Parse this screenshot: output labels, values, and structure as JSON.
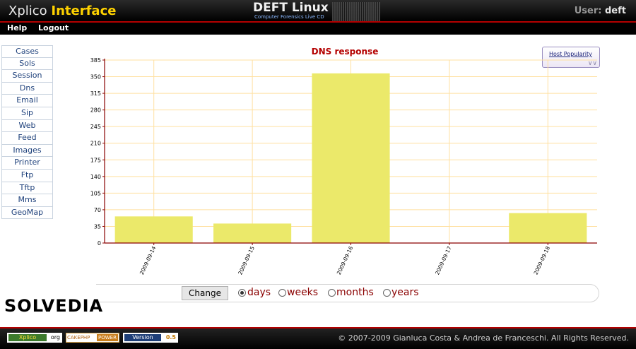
{
  "header": {
    "logo_main": "Xplico ",
    "logo_accent": "Interface",
    "distro_title": "DEFT Linux",
    "distro_subtitle": "Computer Forensics Live CD",
    "user_label": "User: ",
    "user_name": "deft"
  },
  "menu": {
    "help": "Help",
    "logout": "Logout"
  },
  "sidebar": {
    "items": [
      {
        "label": "Cases"
      },
      {
        "label": "Sols"
      },
      {
        "label": "Session"
      },
      {
        "label": "Dns"
      },
      {
        "label": "Email"
      },
      {
        "label": "Sip"
      },
      {
        "label": "Web"
      },
      {
        "label": "Feed"
      },
      {
        "label": "Images"
      },
      {
        "label": "Printer"
      },
      {
        "label": "Ftp"
      },
      {
        "label": "Tftp"
      },
      {
        "label": "Mms"
      },
      {
        "label": "GeoMap"
      }
    ]
  },
  "host_popularity_link": "Host Popularity",
  "chart_data": {
    "type": "bar",
    "title": "DNS response",
    "categories": [
      "2009-09-14",
      "2009-09-15",
      "2009-09-16",
      "2009-09-17",
      "2009-09-18"
    ],
    "values": [
      56,
      41,
      357,
      0,
      63
    ],
    "yticks": [
      "0",
      "35",
      "70",
      "105",
      "140",
      "175",
      "210",
      "245",
      "280",
      "315",
      "350",
      "385"
    ],
    "ylim": [
      0,
      385
    ],
    "grid": true,
    "bar_color": "#ebe96a",
    "grid_color": "#ffe0a0"
  },
  "period": {
    "change_button": "Change",
    "options": [
      {
        "label": "days",
        "selected": true
      },
      {
        "label": "weeks",
        "selected": false
      },
      {
        "label": "months",
        "selected": false
      },
      {
        "label": "years",
        "selected": false
      }
    ]
  },
  "captcha_brand": "SOLVEDIA",
  "footer": {
    "badge_xplico_left": "Xplico",
    "badge_xplico_right": "org",
    "badge_cake_left": "CAKEPHP",
    "badge_cake_right": "POWER",
    "badge_version_left": "Version",
    "badge_version_right": "0.5",
    "copyright": "© 2007-2009 Gianluca Costa & Andrea de Franceschi. All Rights Reserved."
  },
  "colors": {
    "accent_red": "#b40000",
    "logo_yellow": "#ffd200"
  }
}
